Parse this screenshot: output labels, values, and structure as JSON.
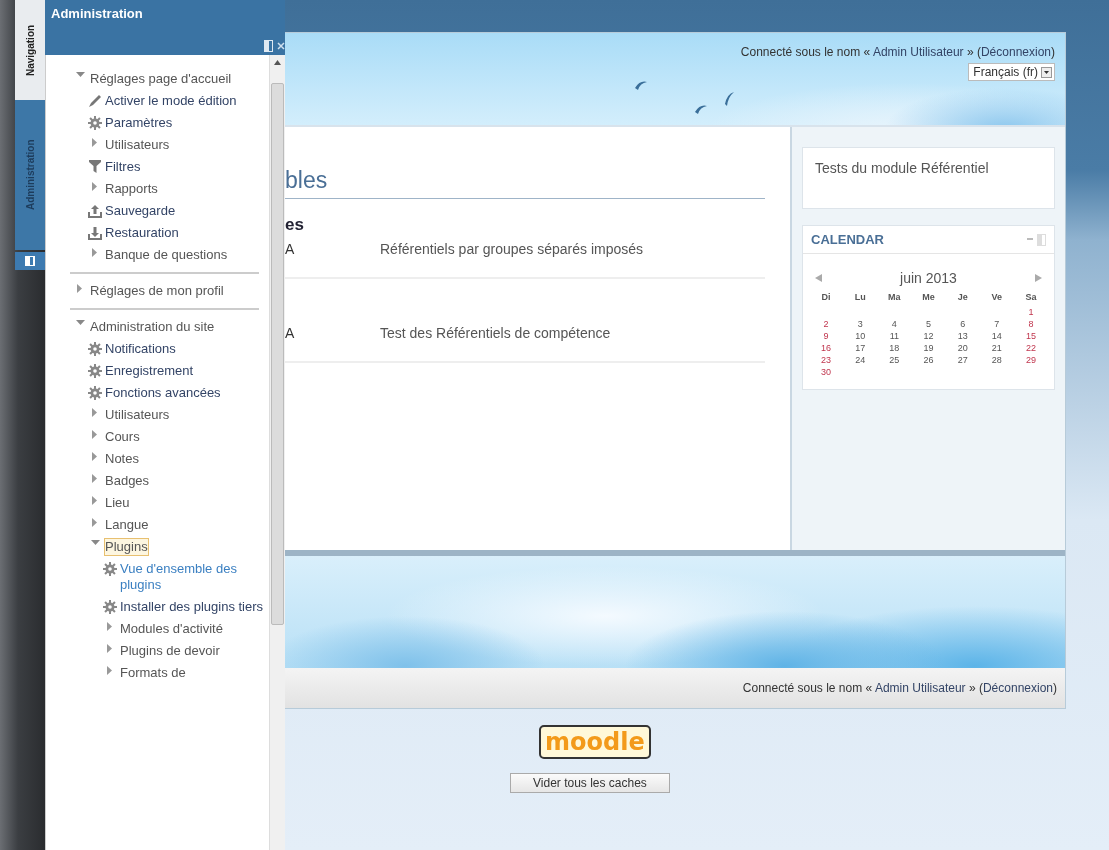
{
  "dock_tabs": [
    {
      "label": "Navigation",
      "selected": false
    },
    {
      "label": "Administration",
      "selected": true
    }
  ],
  "dock": {
    "title": "Administration",
    "tree": [
      {
        "label": "Réglages page d'accueil",
        "kind": "branch",
        "expanded": true,
        "focused": false,
        "active": false,
        "children": [
          {
            "label": "Activer le mode édition",
            "kind": "edit",
            "focused": false,
            "active": false
          },
          {
            "label": "Paramètres",
            "kind": "settings",
            "focused": false,
            "active": false
          },
          {
            "label": "Utilisateurs",
            "kind": "branch",
            "expanded": false,
            "focused": false,
            "active": false
          },
          {
            "label": "Filtres",
            "kind": "filter",
            "focused": false,
            "active": false
          },
          {
            "label": "Rapports",
            "kind": "branch",
            "expanded": false,
            "focused": false,
            "active": false
          },
          {
            "label": "Sauvegarde",
            "kind": "backup",
            "focused": false,
            "active": false
          },
          {
            "label": "Restauration",
            "kind": "restore",
            "focused": false,
            "active": false
          },
          {
            "label": "Banque de questions",
            "kind": "branch",
            "expanded": false,
            "focused": false,
            "active": false
          }
        ]
      },
      {
        "label": "Réglages de mon profil",
        "kind": "branch",
        "expanded": false,
        "focused": false,
        "active": false
      },
      {
        "label": "Administration du site",
        "kind": "branch",
        "expanded": true,
        "focused": false,
        "active": false,
        "children": [
          {
            "label": "Notifications",
            "kind": "settings",
            "focused": false,
            "active": false
          },
          {
            "label": "Enregistrement",
            "kind": "settings",
            "focused": false,
            "active": false
          },
          {
            "label": "Fonctions avancées",
            "kind": "settings",
            "focused": false,
            "active": false
          },
          {
            "label": "Utilisateurs",
            "kind": "branch",
            "expanded": false,
            "focused": false,
            "active": false
          },
          {
            "label": "Cours",
            "kind": "branch",
            "expanded": false,
            "focused": false,
            "active": false
          },
          {
            "label": "Notes",
            "kind": "branch",
            "expanded": false,
            "focused": false,
            "active": false
          },
          {
            "label": "Badges",
            "kind": "branch",
            "expanded": false,
            "focused": false,
            "active": false
          },
          {
            "label": "Lieu",
            "kind": "branch",
            "expanded": false,
            "focused": false,
            "active": false
          },
          {
            "label": "Langue",
            "kind": "branch",
            "expanded": false,
            "focused": false,
            "active": false
          },
          {
            "label": "Plugins",
            "kind": "branch",
            "expanded": true,
            "focused": true,
            "active": false,
            "children": [
              {
                "label": "Vue d'ensemble des plugins",
                "kind": "settings",
                "focused": false,
                "active": true
              },
              {
                "label": "Installer des plugins tiers",
                "kind": "settings",
                "focused": false,
                "active": false
              },
              {
                "label": "Modules d'activité",
                "kind": "branch",
                "expanded": false,
                "focused": false,
                "active": false
              },
              {
                "label": "Plugins de devoir",
                "kind": "branch",
                "expanded": false,
                "focused": false,
                "active": false
              },
              {
                "label": "Formats de",
                "kind": "branch",
                "expanded": false,
                "focused": false,
                "active": false
              }
            ]
          }
        ]
      }
    ]
  },
  "header": {
    "login": {
      "before": "Connecté sous le nom « ",
      "user": "Admin Utilisateur",
      "middle": " » (",
      "logout": "Déconnexion",
      "after": ")"
    },
    "language": "Français (fr)"
  },
  "main": {
    "heading": "bles",
    "subheading": "es",
    "rows": [
      {
        "column_1": "A",
        "column_2": "Référentiels par groupes séparés imposés"
      },
      {
        "column_1": "A",
        "column_2": "Test des Référentiels de compétence"
      }
    ]
  },
  "side": {
    "block_text": "Tests du module Référentiel",
    "calendar": {
      "title": "CALENDAR",
      "month": "juin 2013",
      "day_names": [
        {
          "label": "Di",
          "weekend": true
        },
        {
          "label": "Lu",
          "weekend": false
        },
        {
          "label": "Ma",
          "weekend": false
        },
        {
          "label": "Me",
          "weekend": false
        },
        {
          "label": "Je",
          "weekend": false
        },
        {
          "label": "Ve",
          "weekend": false
        },
        {
          "label": "Sa",
          "weekend": true
        }
      ],
      "weeks": [
        {
          "kind": "first",
          "days": [
            "1"
          ]
        },
        {
          "kind": "full",
          "days": [
            "2",
            "3",
            "4",
            "5",
            "6",
            "7",
            "8"
          ]
        },
        {
          "kind": "full",
          "days": [
            "9",
            "10",
            "11",
            "12",
            "13",
            "14",
            "15"
          ]
        },
        {
          "kind": "full",
          "days": [
            "16",
            "17",
            "18",
            "19",
            "20",
            "21",
            "22"
          ]
        },
        {
          "kind": "full",
          "days": [
            "23",
            "24",
            "25",
            "26",
            "27",
            "28",
            "29"
          ]
        },
        {
          "kind": "last",
          "days": [
            "30"
          ]
        }
      ]
    }
  },
  "footer": {
    "login": {
      "before": "Connecté sous le nom « ",
      "user": "Admin Utilisateur",
      "middle": " » (",
      "logout": "Déconnexion",
      "after": ")"
    },
    "logo": "moodle",
    "button": "Vider tous les caches"
  }
}
